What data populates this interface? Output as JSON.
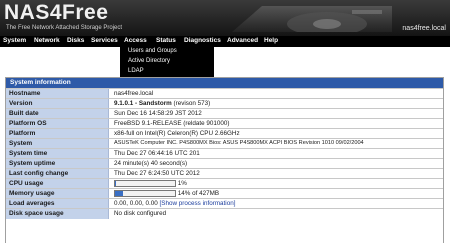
{
  "header": {
    "logo_text": "NAS4Free",
    "tagline": "The Free Network Attached Storage Project",
    "hostname": "nas4free.local"
  },
  "nav": {
    "items": [
      "System",
      "Network",
      "Disks",
      "Services",
      "Access",
      "Status",
      "Diagnostics",
      "Advanced",
      "Help"
    ]
  },
  "dropdown": {
    "items": [
      "Users and Groups",
      "Active Directory",
      "LDAP"
    ]
  },
  "info": {
    "title": "System information",
    "rows": [
      {
        "key": "Hostname",
        "value": "nas4free.local"
      },
      {
        "key": "Version",
        "value_bold": "9.1.0.1 - Sandstorm",
        "value_rest": " (revison 573)"
      },
      {
        "key": "Built date",
        "value": "Sun Dec 16 14:58:29 JST 2012"
      },
      {
        "key": "Platform OS",
        "value": "FreeBSD 9.1-RELEASE (reldate 901000)"
      },
      {
        "key": "Platform",
        "value": "x86-full on Intel(R) Celeron(R) CPU 2.66GHz"
      },
      {
        "key": "System",
        "value": "ASUSTeK Computer INC. P4S800MX Bios: ASUS P4S800MX ACPI BIOS Revision 1010 09/02/2004"
      },
      {
        "key": "System time",
        "value": "Thu Dec 27 06:44:16 UTC 201"
      },
      {
        "key": "System uptime",
        "value": "24 minute(s) 40 second(s)"
      },
      {
        "key": "Last config change",
        "value": "Thu Dec 27 6:24:50 UTC 2012"
      },
      {
        "key": "CPU usage",
        "value": "1%",
        "bar_fraction": 0.01
      },
      {
        "key": "Memory usage",
        "value": "14% of 427MB",
        "bar_fraction": 0.14
      },
      {
        "key": "Load averages",
        "value": "0.00, 0.00, 0.00",
        "link": "[Show process information]"
      },
      {
        "key": "Disk space usage",
        "value": "No disk configured"
      }
    ]
  },
  "colors": {
    "header_bg": "#1e1e1e",
    "nav_bg": "#000000",
    "table_header": "#2e5aa8",
    "key_cell": "#c3d2ea",
    "bar_fill": "#3a6fc4"
  }
}
